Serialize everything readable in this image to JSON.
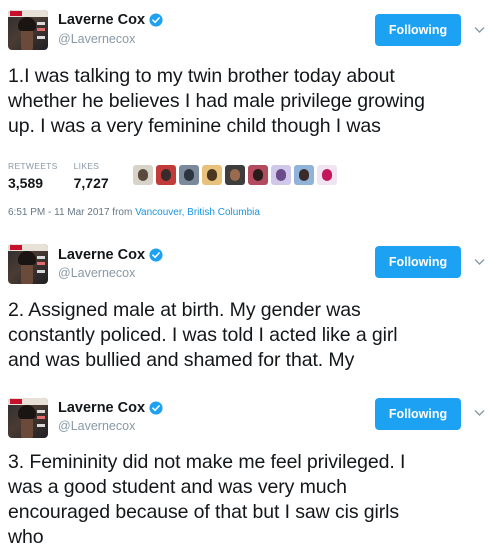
{
  "colors": {
    "accent": "#1da1f2",
    "verified": "#1da1f2",
    "muted": "#8899a6",
    "link": "#1b95e0"
  },
  "tweets": [
    {
      "name": "Laverne Cox",
      "handle": "@Lavernecox",
      "follow_label": "Following",
      "text": "1.I was talking to my twin brother today about\nwhether he believes I had male privilege growing\nup. I was a very feminine child though I was",
      "retweets_label": "RETWEETS",
      "retweets": "3,589",
      "likes_label": "LIKES",
      "likes": "7,727",
      "likers": [
        "liker-avatar-1",
        "liker-avatar-2",
        "liker-avatar-3",
        "liker-avatar-4",
        "liker-avatar-5",
        "liker-avatar-6",
        "liker-avatar-7",
        "liker-avatar-8",
        "liker-avatar-9"
      ],
      "time": "6:51 PM - 11 Mar 2017 from ",
      "location": "Vancouver, British Columbia"
    },
    {
      "name": "Laverne Cox",
      "handle": "@Lavernecox",
      "follow_label": "Following",
      "text": "2. Assigned male at birth. My gender was\nconstantly policed. I was told I acted like a girl\nand was bullied and shamed for that. My"
    },
    {
      "name": "Laverne Cox",
      "handle": "@Lavernecox",
      "follow_label": "Following",
      "text": "3. Femininity did not make me feel privileged.  I\nwas a good student and was very much\nencouraged because of that but I saw cis girls\nwho"
    }
  ]
}
